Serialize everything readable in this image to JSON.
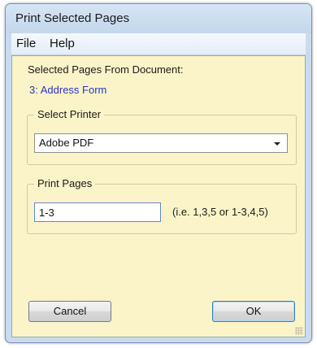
{
  "window": {
    "title": "Print Selected Pages"
  },
  "menu": {
    "items": [
      {
        "label": "File"
      },
      {
        "label": "Help"
      }
    ]
  },
  "selected_pages": {
    "label": "Selected Pages From Document:",
    "pages": [
      "3: Address Form"
    ]
  },
  "printer": {
    "group_label": "Select Printer",
    "selected": "Adobe PDF"
  },
  "print_pages": {
    "group_label": "Print Pages",
    "value": "1-3",
    "hint": "(i.e. 1,3,5 or 1-3,4,5)"
  },
  "buttons": {
    "cancel": "Cancel",
    "ok": "OK"
  },
  "colors": {
    "client_background": "#fbf4c8",
    "page_link": "#2a34c8",
    "title_bar": "#c9dcef"
  }
}
